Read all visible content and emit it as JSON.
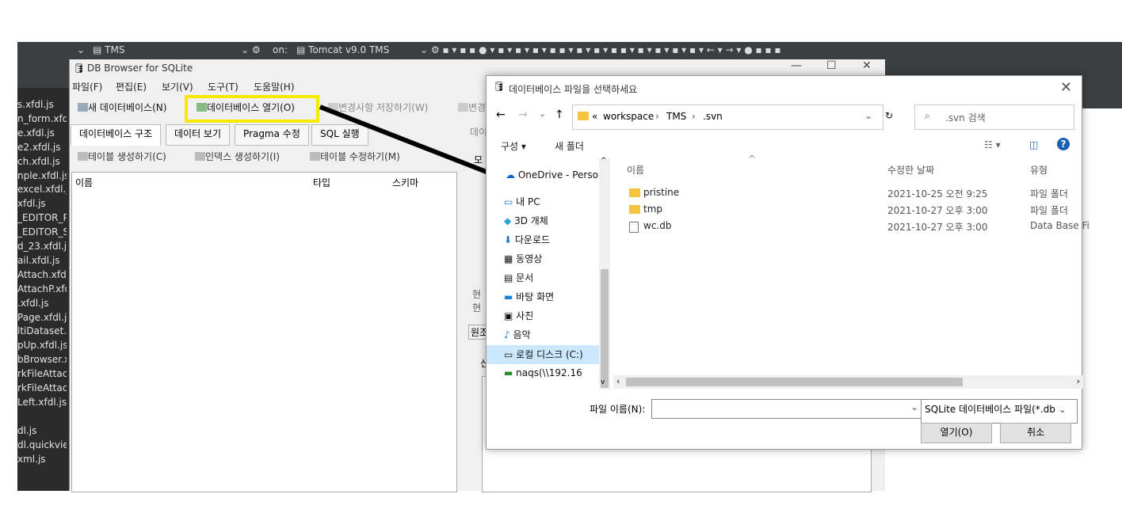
{
  "eclipse": {
    "project": "TMS",
    "server_prefix": "on:",
    "server": "Tomcat v9.0 TMS",
    "files": [
      "s.xfdl.js",
      "n_form.xfdl",
      "e.xfdl.js",
      "e2.xfdl.js",
      "ch.xfdl.js",
      "nple.xfdl.js",
      "excel.xfdl.js",
      "xfdl.js",
      "_EDITOR_P",
      "_EDITOR_S",
      "d_23.xfdl.js",
      "ail.xfdl.js",
      "Attach.xfdl",
      "AttachP.xfd",
      ".xfdl.js",
      "Page.xfdl.js",
      "ltiDataset.x",
      "pUp.xfdl.js",
      "bBrowser.x",
      "rkFileAttac",
      "rkFileAttac",
      "Left.xfdl.js",
      "",
      "dl.js",
      "dl.quickviev",
      "xml.js"
    ]
  },
  "dbbrowser": {
    "title": "DB Browser for SQLite",
    "menu": [
      "파일(F)",
      "편집(E)",
      "보기(V)",
      "도구(T)",
      "도움말(H)"
    ],
    "toolbar": {
      "new_db": "새 데이터베이스(N)",
      "open_db": "데이터베이스 열기(O)",
      "save": "변경사항 저장하기(W)",
      "other": "변경"
    },
    "tabs": [
      "데이터베이스 구조",
      "데이터 보기",
      "Pragma 수정",
      "SQL 실행"
    ],
    "actions": [
      "테이블 생성하기(C)",
      "인덱스 생성하기(I)",
      "테이블 수정하기(M)"
    ],
    "columns": [
      "이름",
      "타입",
      "스키마"
    ],
    "right_fragments": {
      "data_tab": "데이",
      "mo": "모",
      "cur1": "현",
      "cur2": "현",
      "orig": "원조",
      "s": "신"
    }
  },
  "dialog": {
    "title": "데이터베이스 파일을 선택하세요",
    "breadcrumb": [
      "workspace",
      "TMS",
      ".svn"
    ],
    "breadcrumb_prefix": "«",
    "search_placeholder": ".svn 검색",
    "organize": "구성 ▾",
    "new_folder": "새 폴더",
    "nav": [
      "OneDrive - Persoı",
      "내 PC",
      "3D 개체",
      "다운로드",
      "동영상",
      "문서",
      "바탕 화면",
      "사진",
      "음악",
      "로컬 디스크 (C:)",
      "naqs(\\\\192.16"
    ],
    "headers": {
      "name": "이름",
      "modified": "수정한 날짜",
      "type": "유형"
    },
    "files": [
      {
        "name": "pristine",
        "modified": "2021-10-25 오전 9:25",
        "type": "파일 폴더",
        "kind": "folder"
      },
      {
        "name": "tmp",
        "modified": "2021-10-27 오후 3:00",
        "type": "파일 폴더",
        "kind": "folder"
      },
      {
        "name": "wc.db",
        "modified": "2021-10-27 오후 3:00",
        "type": "Data Base Fi",
        "kind": "file"
      }
    ],
    "filename_label": "파일 이름(N):",
    "filename_value": "",
    "filter": "SQLite 데이터베이스 파일(*.db",
    "open_button": "열기(O)",
    "cancel_button": "취소"
  },
  "colors": {
    "highlight": "#f7ea00",
    "arrow": "#000000",
    "eclipse_dark": "#3c3f41"
  }
}
